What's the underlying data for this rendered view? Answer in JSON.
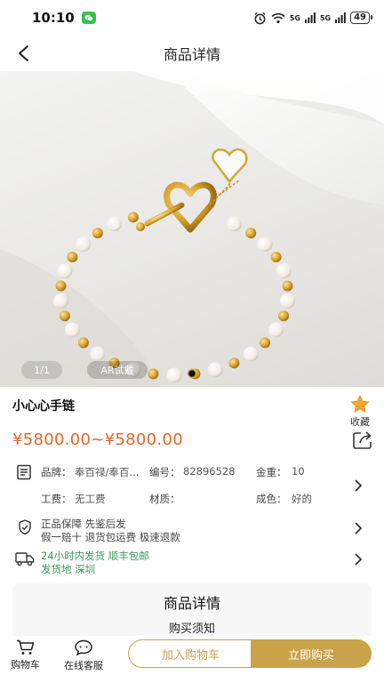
{
  "status_bar": {
    "time": "10:10",
    "signal_1": "5G",
    "signal_2": "5G",
    "battery": "49"
  },
  "header": {
    "title": "商品详情"
  },
  "gallery": {
    "counter": "1/1",
    "ar_label": "AR试戴"
  },
  "product": {
    "name": "小心心手链",
    "price": "¥5800.00~¥5800.00",
    "favorite_label": "收藏"
  },
  "specs": {
    "brand_label": "品牌：",
    "brand_value": "奉百禄/奉百...",
    "code_label": "编号：",
    "code_value": "82896528",
    "weight_label": "金重：",
    "weight_value": "10",
    "labor_label": "工费：",
    "labor_value": "无工费",
    "material_label": "材质：",
    "material_value": "",
    "color_label": "成色：",
    "color_value": "好的"
  },
  "guarantee": {
    "line1": "正品保障 先鉴后发",
    "line2": "假一赔十 退货包运费 极速退款"
  },
  "shipping": {
    "line1": "24小时内发货 顺丰包邮",
    "line2": "发货地 深圳"
  },
  "details": {
    "title": "商品详情",
    "subtitle": "购买须知"
  },
  "bottom_bar": {
    "cart_tab": "购物车",
    "service_tab": "在线客服",
    "add_to_cart": "加入购物车",
    "buy_now": "立即购买"
  },
  "colors": {
    "price": "#e0662b",
    "gold": "#c9a24a",
    "star": "#f2a632",
    "shipping_green": "#3a9a57"
  }
}
